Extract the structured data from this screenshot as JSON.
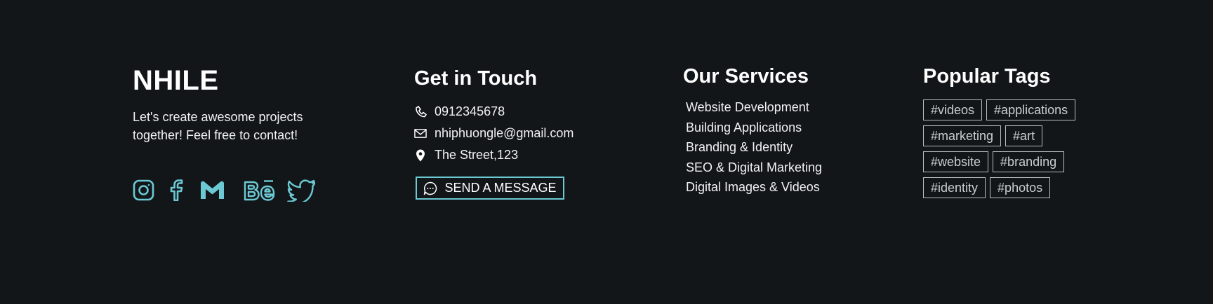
{
  "brand": {
    "name": "NHILE",
    "tagline": "Let's create awesome projects together! Feel free to contact!"
  },
  "social": {
    "color": "#6cc9d3",
    "icons": [
      "instagram-icon",
      "facebook-icon",
      "gmail-icon",
      "behance-icon",
      "twitter-icon"
    ]
  },
  "contact": {
    "title": "Get in Touch",
    "phone": "0912345678",
    "email": "nhiphuongle@gmail.com",
    "address": "The Street,123",
    "button_label": "SEND A MESSAGE"
  },
  "services": {
    "title": "Our Services",
    "items": [
      "Website Development",
      "Building Applications",
      "Branding & Identity",
      "SEO & Digital Marketing",
      "Digital Images & Videos"
    ]
  },
  "tags": {
    "title": "Popular Tags",
    "items": [
      "#videos",
      "#applications",
      "#marketing",
      "#art",
      "#website",
      "#branding",
      "#identity",
      "#photos"
    ]
  },
  "colors": {
    "background": "#121619",
    "accent": "#6cc9d3",
    "text": "#ffffff",
    "tag_border": "#b9bec2"
  }
}
